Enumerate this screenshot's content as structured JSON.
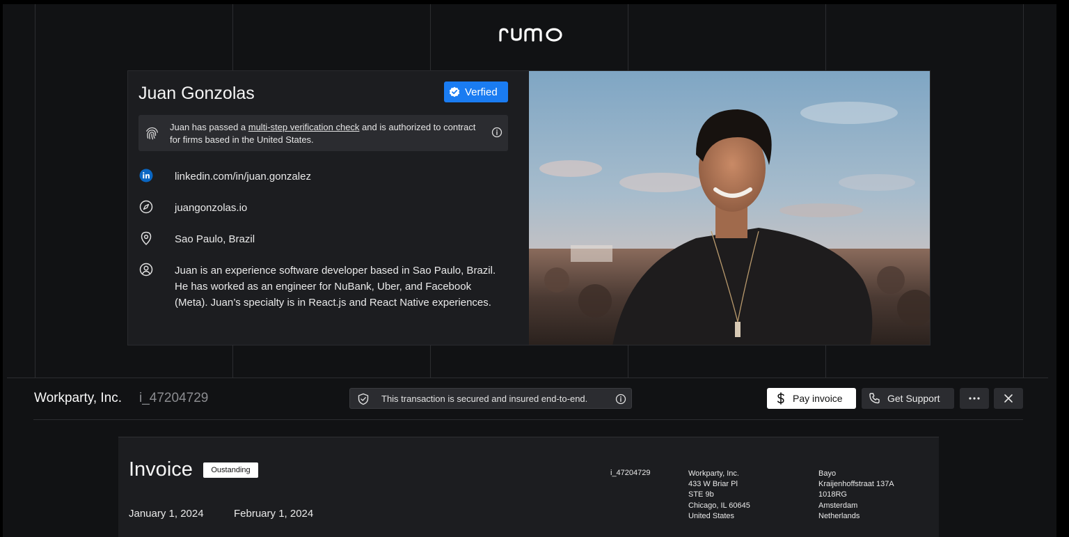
{
  "brand": {
    "logo_text": "rumo"
  },
  "profile": {
    "name": "Juan Gonzolas",
    "verified_label": "Verfied",
    "verification": {
      "prefix": "Juan has passed a ",
      "link": "multi-step verification check",
      "suffix": " and is authorized to contract for firms based in the United States."
    },
    "linkedin": "linkedin.com/in/juan.gonzalez",
    "website": "juangonzolas.io",
    "location": "Sao Paulo, Brazil",
    "bio": "Juan is an experience software developer based in Sao Paulo, Brazil. He has worked as an engineer for NuBank, Uber, and Facebook (Meta). Juan’s specialty is in React.js and React Native experiences."
  },
  "toolbar": {
    "company": "Workparty, Inc.",
    "invoice_id": "i_47204729",
    "secure_text": "This transaction is secured and insured end-to-end.",
    "pay_label": "Pay invoice",
    "support_label": "Get Support"
  },
  "invoice": {
    "title": "Invoice",
    "status": "Oustanding",
    "issue_date": "January 1, 2024",
    "due_date": "February 1, 2024",
    "id": "i_47204729",
    "from": [
      "Workparty, Inc.",
      "433 W Briar Pl",
      "STE 9b",
      "Chicago, IL 60645",
      "United States"
    ],
    "to": [
      "Bayo",
      "Kraijenhoffstraat 137A",
      "1018RG",
      "Amsterdam",
      "Netherlands"
    ]
  },
  "colors": {
    "background": "#111214",
    "card": "#1c1d20",
    "verified_blue": "#1a7cf2",
    "linkedin_blue": "#0a66c2"
  }
}
